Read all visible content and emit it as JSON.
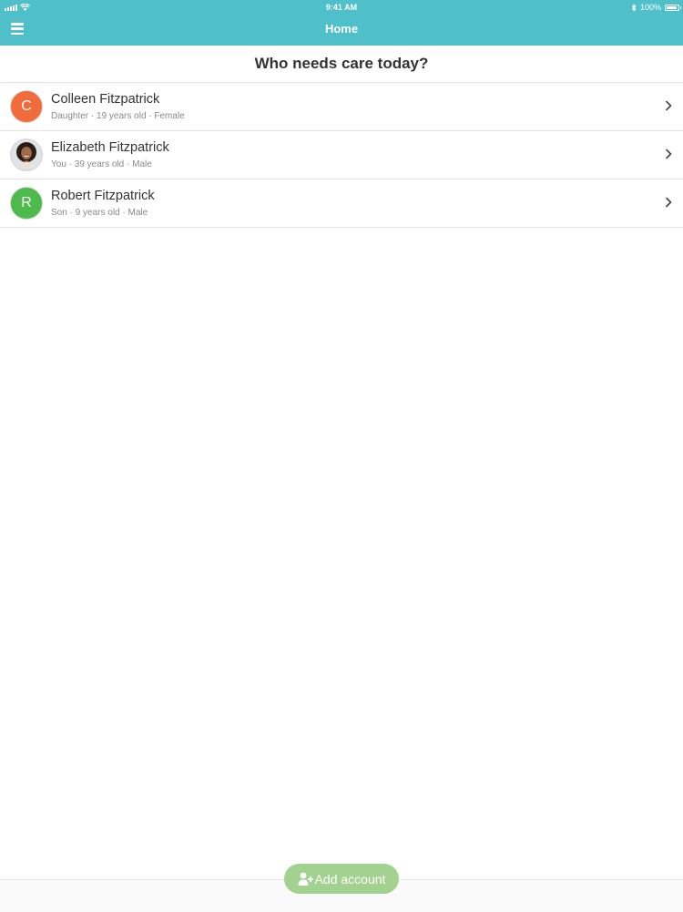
{
  "status_bar": {
    "time": "9:41 AM",
    "battery_text": "100%",
    "icons": [
      "signal-icon",
      "wifi-icon",
      "bluetooth-icon",
      "battery-icon"
    ]
  },
  "nav": {
    "title": "Home",
    "menu_icon": "hamburger-menu-icon"
  },
  "heading": "Who needs care today?",
  "people": [
    {
      "name": "Colleen Fitzpatrick",
      "detail": "Daughter · 19 years old · Female",
      "avatar_initial": "C",
      "avatar_color": "#f26b3a"
    },
    {
      "name": "Elizabeth Fitzpatrick",
      "detail": "You · 39 years old · Male",
      "avatar_initial": "",
      "avatar_color": "#dfe3e6"
    },
    {
      "name": "Robert Fitzpatrick",
      "detail": "Son · 9 years old · Male",
      "avatar_initial": "R",
      "avatar_color": "#4cbb4c"
    }
  ],
  "add_account_label": "Add account",
  "colors": {
    "header": "#4fc0ca",
    "add_button": "#a3d18f"
  }
}
